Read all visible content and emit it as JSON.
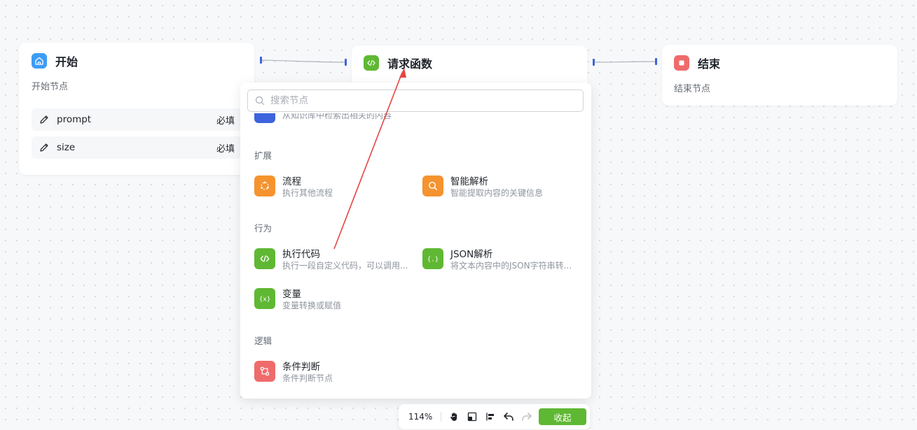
{
  "nodes": {
    "start": {
      "title": "开始",
      "desc": "开始节点",
      "fields": [
        {
          "name": "prompt",
          "required": "必填"
        },
        {
          "name": "size",
          "required": "必填"
        }
      ]
    },
    "request": {
      "title": "请求函数"
    },
    "end": {
      "title": "结束",
      "desc": "结束节点"
    }
  },
  "panel": {
    "search_placeholder": "搜索节点",
    "partial_item_desc": "从知识库中检索出相关的内容",
    "sections": [
      {
        "title": "扩展",
        "items": [
          {
            "title": "流程",
            "desc": "执行其他流程",
            "icon": "flow-icon",
            "color": "#f5932f"
          },
          {
            "title": "智能解析",
            "desc": "智能提取内容的关键信息",
            "icon": "smart-parse-icon",
            "color": "#f5932f"
          }
        ]
      },
      {
        "title": "行为",
        "items": [
          {
            "title": "执行代码",
            "desc": "执行一段自定义代码，可以调用...",
            "icon": "code-icon",
            "color": "#5fb833"
          },
          {
            "title": "JSON解析",
            "desc": "将文本内容中的JSON字符串转...",
            "icon": "json-icon",
            "color": "#5fb833"
          },
          {
            "title": "变量",
            "desc": "变量转换或赋值",
            "icon": "variable-icon",
            "color": "#5fb833"
          }
        ]
      },
      {
        "title": "逻辑",
        "items": [
          {
            "title": "条件判断",
            "desc": "条件判断节点",
            "icon": "condition-icon",
            "color": "#ef6b6b"
          }
        ]
      }
    ]
  },
  "toolbar": {
    "zoom": "114%",
    "collapse_label": "收起"
  },
  "colors": {
    "start_icon": "#3d9cf5",
    "code_green": "#5fb833",
    "end_red": "#ef6b6b",
    "port_blue": "#3d63dd",
    "annotation_arrow": "#e54545"
  }
}
